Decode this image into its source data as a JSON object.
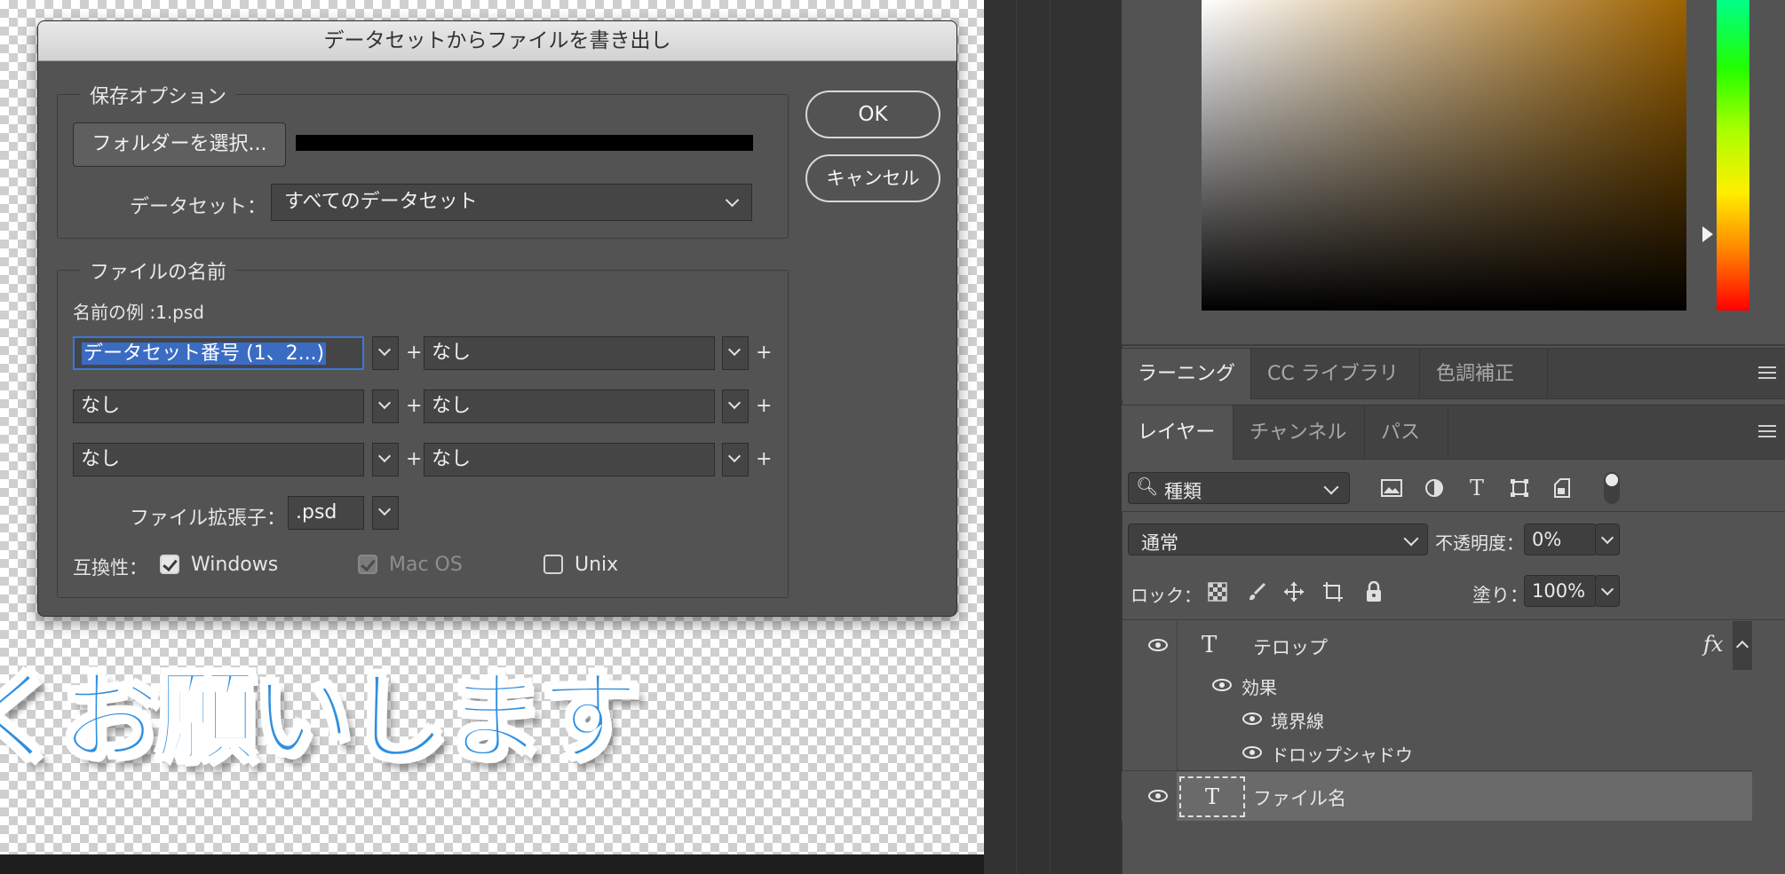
{
  "canvas": {
    "text": "くお願いします"
  },
  "dialog": {
    "title": "データセットからファイルを書き出し",
    "ok_label": "OK",
    "cancel_label": "キャンセル",
    "save_options": {
      "legend": "保存オプション",
      "select_folder_label": "フォルダーを選択...",
      "folder_path": "（非表示のパス）",
      "dataset_label": "データセット：",
      "dataset_value": "すべてのデータセット"
    },
    "file_name": {
      "legend": "ファイルの名前",
      "example_label": "名前の例 :1.psd",
      "rows": [
        {
          "left": "データセット番号 (1、2...)",
          "right": "なし"
        },
        {
          "left": "なし",
          "right": "なし"
        },
        {
          "left": "なし",
          "right": "なし"
        }
      ],
      "plus": "+",
      "extension_label": "ファイル拡張子：",
      "extension_value": ".psd",
      "compat_label": "互換性：",
      "compat": [
        {
          "label": "Windows",
          "checked": true,
          "enabled": true
        },
        {
          "label": "Mac OS",
          "checked": true,
          "enabled": false
        },
        {
          "label": "Unix",
          "checked": false,
          "enabled": true
        }
      ]
    }
  },
  "panels": {
    "tabs_top": [
      "ラーニング",
      "CC ライブラリ",
      "色調補正"
    ],
    "tabs_layers": [
      "レイヤー",
      "チャンネル",
      "パス"
    ],
    "filter_kind": "種類",
    "blend_mode": "通常",
    "opacity_label": "不透明度：",
    "opacity_value": "0%",
    "lock_label": "ロック：",
    "fill_label": "塗り：",
    "fill_value": "100%",
    "layers": [
      {
        "name": "テロップ",
        "fx": "fx"
      },
      {
        "name": "効果"
      },
      {
        "name": "境界線"
      },
      {
        "name": "ドロップシャドウ"
      },
      {
        "name": "ファイル名"
      }
    ]
  }
}
